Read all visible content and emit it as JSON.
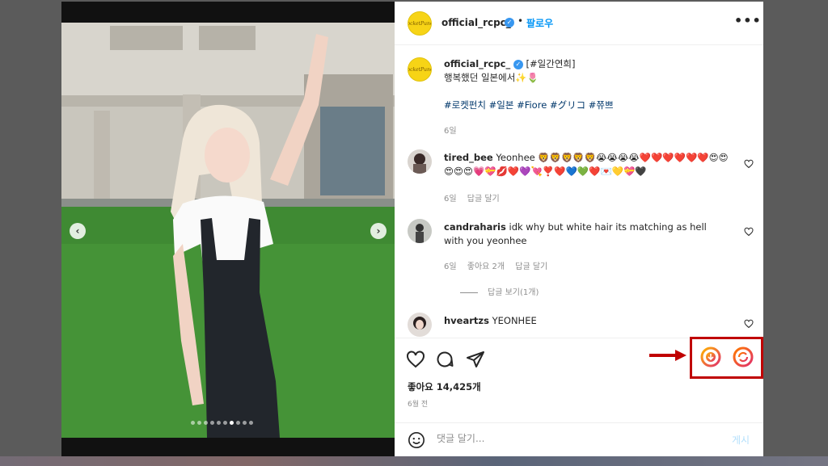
{
  "post": {
    "username": "official_rcpc_",
    "follow_label": "팔로우",
    "separator": "•",
    "more_label": "•••",
    "avatar_text": "RocketPunch",
    "verified_mark": "✓"
  },
  "caption": {
    "username": "official_rcpc_",
    "tag": "[#일간연희]",
    "line1": "행복했던 일본에서✨🌷",
    "hashtags": [
      "#로켓펀치",
      "#일본",
      "#Fiore",
      "#グリコ",
      "#쮸쁘"
    ],
    "age": "6일"
  },
  "comments": [
    {
      "username": "tired_bee",
      "text": "Yeonhee 🦁🦁🦁🦁🦁😭😭😭😭❤️❤️❤️❤️❤️❤️😍😍😍😍😍💗💝💋❤️💜💘❣️❤️💙💚❤️💌💛💝🖤",
      "age": "6일",
      "likes": "",
      "reply": "답글 달기"
    },
    {
      "username": "candraharis",
      "text": "idk why but white hair its matching as hell with you yeonhee",
      "age": "6일",
      "likes": "좋아요 2개",
      "reply": "답글 달기",
      "view_replies": "답글 보기(1개)"
    },
    {
      "username": "hveartzs",
      "text": "YEONHEE"
    }
  ],
  "actions": {
    "likes_text": "좋아요 14,425개",
    "time": "6월 전"
  },
  "comment_box": {
    "placeholder": "댓글 달기...",
    "post_label": "게시"
  },
  "photo": {
    "prev": "‹",
    "next": "›",
    "dots_count": 10,
    "active_dot": 6
  },
  "colors": {
    "accent": "#0095f6",
    "highlight_border": "#c00000",
    "avatar_bg": "#f7d416"
  }
}
